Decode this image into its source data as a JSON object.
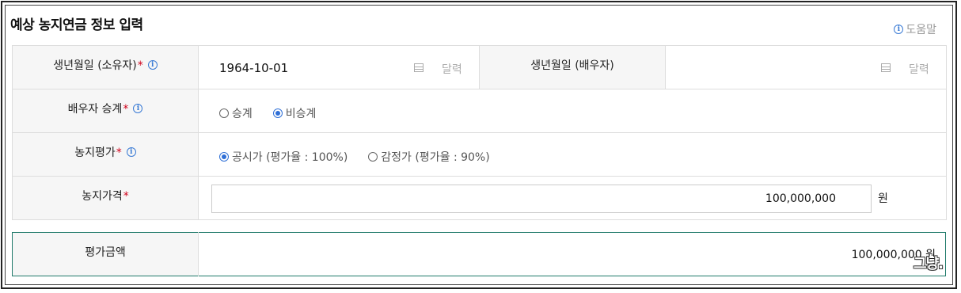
{
  "header": {
    "title": "예상 농지연금 정보 입력",
    "help_label": "도움말"
  },
  "form": {
    "birth_owner": {
      "label": "생년월일 (소유자)",
      "value": "1964-10-01",
      "calendar_label": "달력"
    },
    "birth_spouse": {
      "label": "생년월일 (배우자)",
      "value": "",
      "calendar_label": "달력"
    },
    "spouse_succession": {
      "label": "배우자 승계",
      "options": [
        "승계",
        "비승계"
      ],
      "selected": "비승계"
    },
    "land_valuation": {
      "label": "농지평가",
      "options": [
        "공시가 (평가율 : 100%)",
        "감정가 (평가율 : 90%)"
      ],
      "selected": "공시가 (평가율 : 100%)"
    },
    "land_price": {
      "label": "농지가격",
      "value": "100,000,000",
      "unit": "원"
    }
  },
  "result": {
    "label": "평가금액",
    "value": "100,000,000 원"
  },
  "watermark": "그냥.",
  "required_mark": "*",
  "colors": {
    "accent": "#2f6fd6",
    "required": "#d0021b",
    "result_border": "#1f7a6a",
    "label_bg": "#f6f6f6"
  }
}
